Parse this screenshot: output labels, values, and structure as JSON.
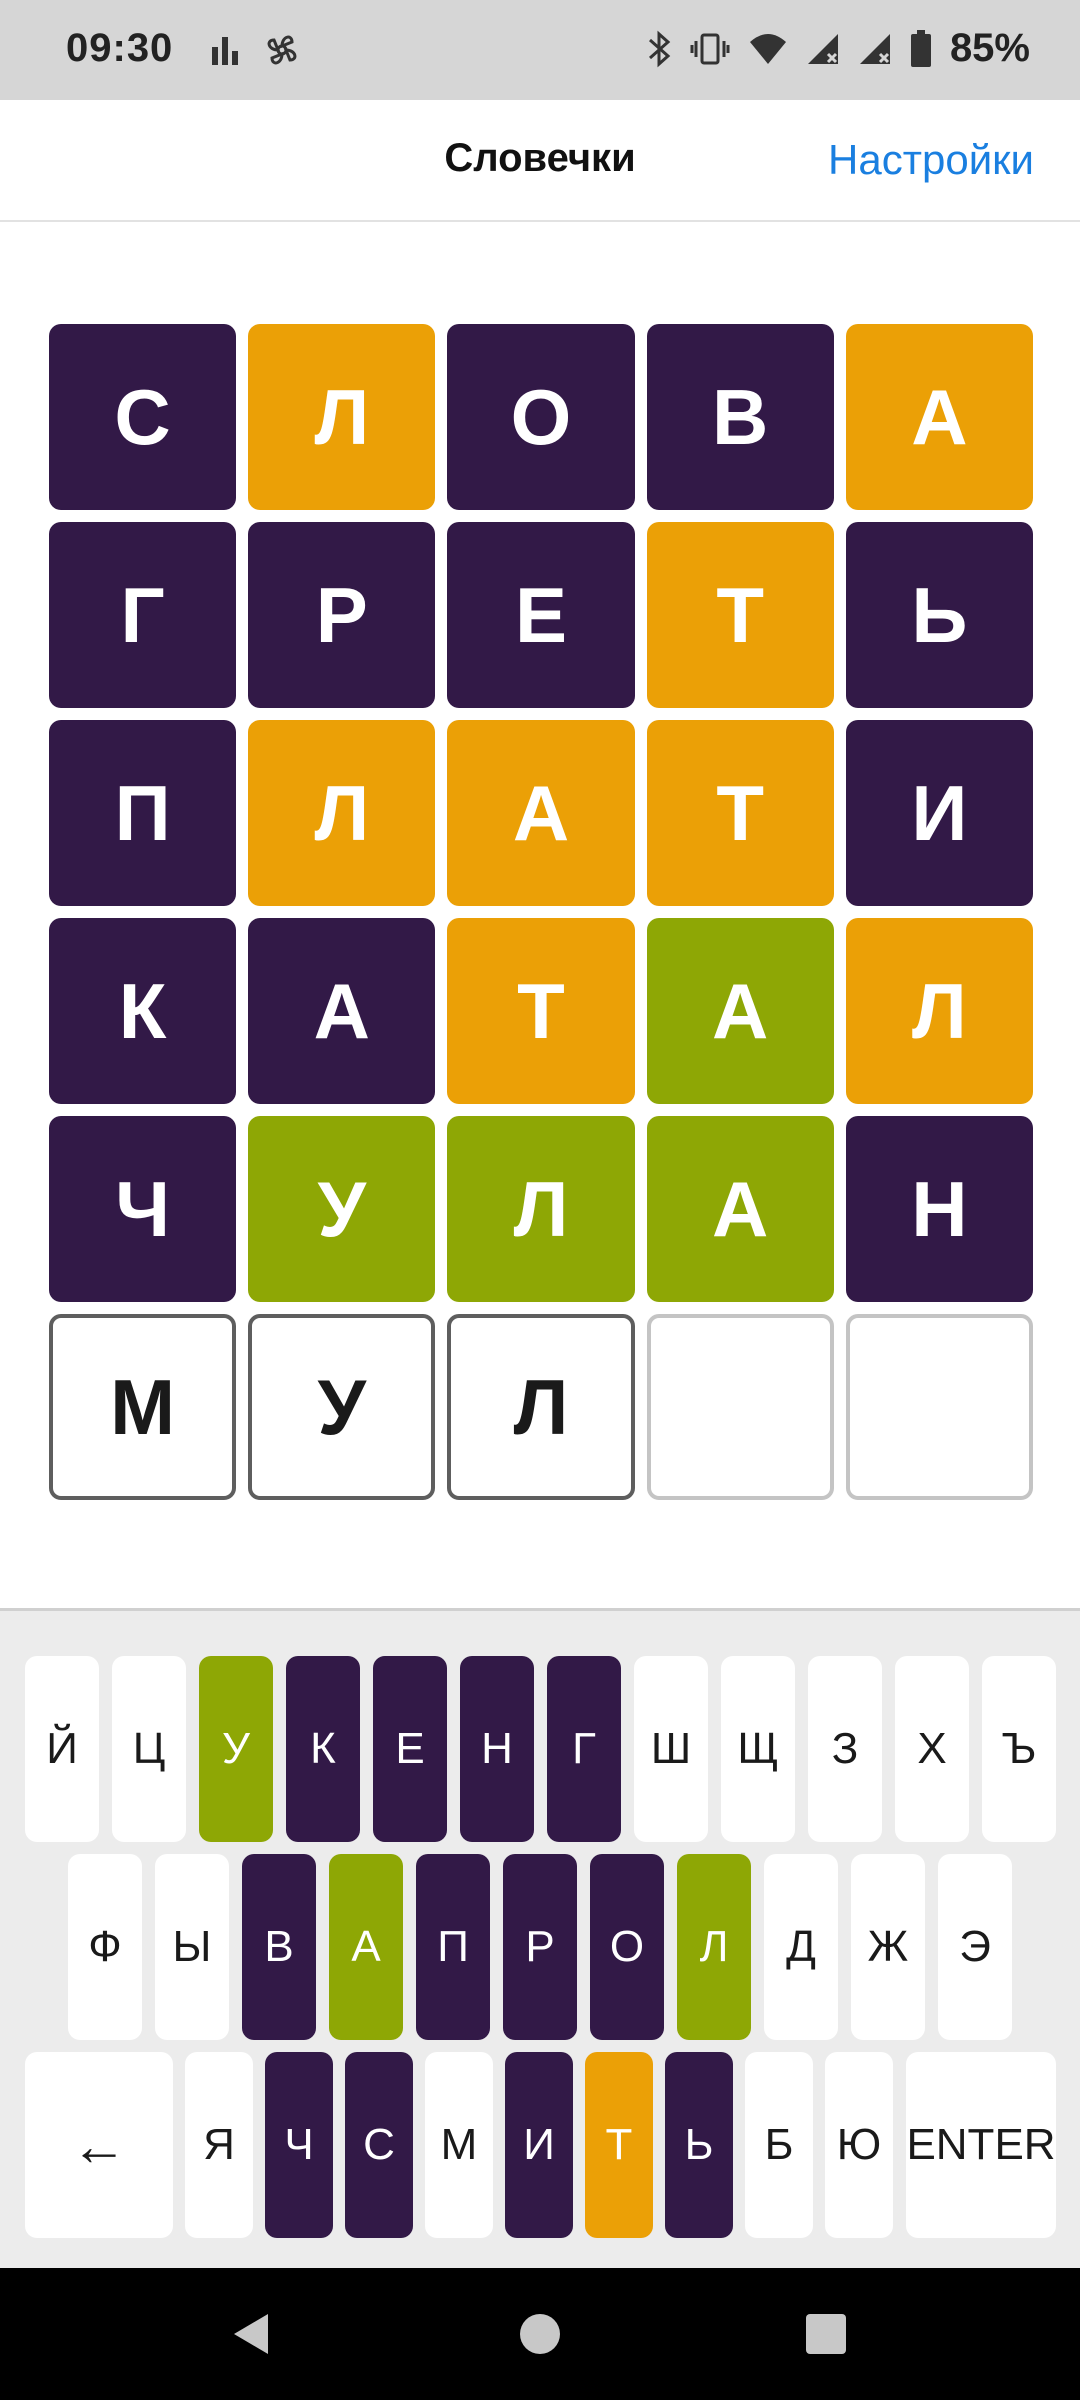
{
  "status_bar": {
    "time": "09:30",
    "battery": "85%",
    "icons": [
      "bar-chart-icon",
      "pinwheel-icon",
      "bluetooth-icon",
      "vibrate-icon",
      "wifi-icon",
      "signal-icon",
      "signal-icon",
      "battery-icon"
    ]
  },
  "header": {
    "title": "Словечки",
    "settings_label": "Настройки"
  },
  "board": {
    "rows": [
      [
        {
          "l": "С",
          "s": "absent"
        },
        {
          "l": "Л",
          "s": "present"
        },
        {
          "l": "О",
          "s": "absent"
        },
        {
          "l": "В",
          "s": "absent"
        },
        {
          "l": "А",
          "s": "present"
        }
      ],
      [
        {
          "l": "Г",
          "s": "absent"
        },
        {
          "l": "Р",
          "s": "absent"
        },
        {
          "l": "Е",
          "s": "absent"
        },
        {
          "l": "Т",
          "s": "present"
        },
        {
          "l": "Ь",
          "s": "absent"
        }
      ],
      [
        {
          "l": "П",
          "s": "absent"
        },
        {
          "l": "Л",
          "s": "present"
        },
        {
          "l": "А",
          "s": "present"
        },
        {
          "l": "Т",
          "s": "present"
        },
        {
          "l": "И",
          "s": "absent"
        }
      ],
      [
        {
          "l": "К",
          "s": "absent"
        },
        {
          "l": "А",
          "s": "absent"
        },
        {
          "l": "Т",
          "s": "present"
        },
        {
          "l": "А",
          "s": "correct"
        },
        {
          "l": "Л",
          "s": "present"
        }
      ],
      [
        {
          "l": "Ч",
          "s": "absent"
        },
        {
          "l": "У",
          "s": "correct"
        },
        {
          "l": "Л",
          "s": "correct"
        },
        {
          "l": "А",
          "s": "correct"
        },
        {
          "l": "Н",
          "s": "absent"
        }
      ],
      [
        {
          "l": "М",
          "s": "filled"
        },
        {
          "l": "У",
          "s": "filled"
        },
        {
          "l": "Л",
          "s": "filled"
        },
        {
          "l": "",
          "s": "empty"
        },
        {
          "l": "",
          "s": "empty"
        }
      ]
    ]
  },
  "keyboard": {
    "rows": [
      [
        {
          "k": "Й",
          "s": ""
        },
        {
          "k": "Ц",
          "s": ""
        },
        {
          "k": "У",
          "s": "correct"
        },
        {
          "k": "К",
          "s": "absent"
        },
        {
          "k": "Е",
          "s": "absent"
        },
        {
          "k": "Н",
          "s": "absent"
        },
        {
          "k": "Г",
          "s": "absent"
        },
        {
          "k": "Ш",
          "s": ""
        },
        {
          "k": "Щ",
          "s": ""
        },
        {
          "k": "З",
          "s": ""
        },
        {
          "k": "Х",
          "s": ""
        },
        {
          "k": "Ъ",
          "s": ""
        }
      ],
      [
        {
          "k": "Ф",
          "s": ""
        },
        {
          "k": "Ы",
          "s": ""
        },
        {
          "k": "В",
          "s": "absent"
        },
        {
          "k": "А",
          "s": "correct"
        },
        {
          "k": "П",
          "s": "absent"
        },
        {
          "k": "Р",
          "s": "absent"
        },
        {
          "k": "О",
          "s": "absent"
        },
        {
          "k": "Л",
          "s": "correct"
        },
        {
          "k": "Д",
          "s": ""
        },
        {
          "k": "Ж",
          "s": ""
        },
        {
          "k": "Э",
          "s": ""
        }
      ],
      [
        {
          "k": "←",
          "s": "",
          "special": "backspace"
        },
        {
          "k": "Я",
          "s": ""
        },
        {
          "k": "Ч",
          "s": "absent"
        },
        {
          "k": "С",
          "s": "absent"
        },
        {
          "k": "М",
          "s": ""
        },
        {
          "k": "И",
          "s": "absent"
        },
        {
          "k": "Т",
          "s": "present"
        },
        {
          "k": "Ь",
          "s": "absent"
        },
        {
          "k": "Б",
          "s": ""
        },
        {
          "k": "Ю",
          "s": ""
        },
        {
          "k": "ENTER",
          "s": "",
          "special": "enter"
        }
      ]
    ]
  },
  "nav_bar": {
    "buttons": [
      "back-icon",
      "home-icon",
      "recents-icon"
    ]
  },
  "colors": {
    "absent": "#321947",
    "present": "#eba006",
    "correct": "#8ea705",
    "link": "#1a7fe0"
  }
}
